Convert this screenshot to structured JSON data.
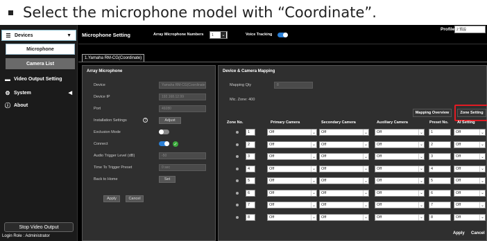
{
  "caption": {
    "text": "Select the microphone model with “Coordinate”."
  },
  "sidebar": {
    "devices": "Devices",
    "microphone": "Microphone",
    "camera_list": "Camera List",
    "video_output": "Video Output Setting",
    "system": "System",
    "about": "About",
    "stop_video": "Stop Video Output",
    "login_role": "Login Role : Administrator"
  },
  "header": {
    "title": "Microphone Setting",
    "array_label": "Array Microphone Numbers",
    "array_value": "1",
    "voice_tracking_label": "Voice Tracking",
    "voice_tracking_on": true,
    "profile_label": "Profile",
    "profile_value": "2 預設"
  },
  "tab": {
    "label": "1.Yamaha RM-CG(Coordinate)"
  },
  "array_mic": {
    "title": "Array Microphone",
    "fields": [
      {
        "label": "Device",
        "value": "Yamaha RM-CG(Coordinate)"
      },
      {
        "label": "Device IP",
        "value": "192.168.12.99"
      },
      {
        "label": "Port",
        "value": "49280"
      }
    ],
    "installation_label": "Installation Settings",
    "adjust": "Adjust",
    "exclusion_label": "Exclusion Mode",
    "exclusion_on": false,
    "connect_label": "Connect",
    "connect_on": true,
    "audio_label": "Audio Trigger Level (dB)",
    "audio_value": "-50",
    "time_label": "Time To Trigger Preset",
    "time_value": "0 sec",
    "back_label": "Back to Home",
    "back_value": "Set",
    "apply": "Apply",
    "cancel": "Cancel"
  },
  "mapping": {
    "title": "Device & Camera Mapping",
    "mapping_qty_label": "Mapping Qty",
    "mapping_qty_value": "8",
    "mic_zone": "Mic. Zone: 400",
    "mapping_overview": "Mapping Overview",
    "zone_setting": "Zone Setting",
    "headers": [
      "Zone No.",
      "Primary Camera",
      "Secondary Camera",
      "Auxiliary Camera",
      "Preset No.",
      "AI Setting"
    ],
    "rows": [
      {
        "zone": "1",
        "primary": "Off",
        "secondary": "Off",
        "aux": "Off",
        "preset": "1",
        "ai": "Off"
      },
      {
        "zone": "2",
        "primary": "Off",
        "secondary": "Off",
        "aux": "Off",
        "preset": "2",
        "ai": "Off"
      },
      {
        "zone": "3",
        "primary": "Off",
        "secondary": "Off",
        "aux": "Off",
        "preset": "3",
        "ai": "Off"
      },
      {
        "zone": "4",
        "primary": "Off",
        "secondary": "Off",
        "aux": "Off",
        "preset": "4",
        "ai": "Off"
      },
      {
        "zone": "5",
        "primary": "Off",
        "secondary": "Off",
        "aux": "Off",
        "preset": "5",
        "ai": "Off"
      },
      {
        "zone": "6",
        "primary": "Off",
        "secondary": "Off",
        "aux": "Off",
        "preset": "6",
        "ai": "Off"
      },
      {
        "zone": "7",
        "primary": "Off",
        "secondary": "Off",
        "aux": "Off",
        "preset": "7",
        "ai": "Off"
      },
      {
        "zone": "8",
        "primary": "Off",
        "secondary": "Off",
        "aux": "Off",
        "preset": "8",
        "ai": "Off"
      }
    ],
    "apply": "Apply",
    "cancel": "Cancel"
  },
  "colors": {
    "accent": "#2a7fd6",
    "highlight": "#e31b23",
    "connected": "#3caa3c"
  }
}
